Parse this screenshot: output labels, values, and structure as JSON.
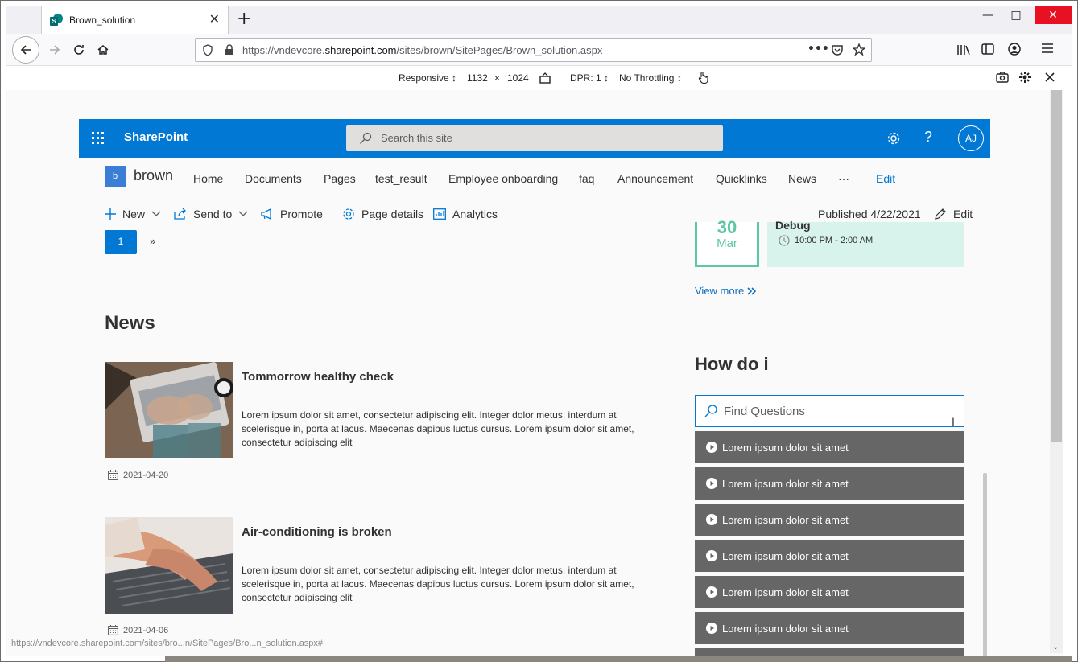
{
  "browser": {
    "tab_title": "Brown_solution",
    "url_prefix": "https://vndevcore.",
    "url_domain": "sharepoint.com",
    "url_suffix": "/sites/brown/SitePages/Brown_solution.aspx",
    "status_url": "https://vndevcore.sharepoint.com/sites/bro...n/SitePages/Bro...n_solution.aspx#"
  },
  "rdm": {
    "device": "Responsive ↕",
    "width": "1132",
    "times": "×",
    "height": "1024",
    "dpr": "DPR: 1 ↕",
    "throttle": "No Throttling ↕"
  },
  "suite": {
    "brand": "SharePoint",
    "search_placeholder": "Search this site",
    "avatar": "AJ",
    "help": "?"
  },
  "site": {
    "logo_letter": "b",
    "name": "brown",
    "nav": [
      "Home",
      "Documents",
      "Pages",
      "test_result",
      "Employee onboarding",
      "faq",
      "Announcement",
      "Quicklinks",
      "News",
      "···"
    ],
    "edit": "Edit"
  },
  "commands": {
    "new": "New",
    "send_to": "Send to",
    "promote": "Promote",
    "page_details": "Page details",
    "analytics": "Analytics",
    "published": "Published 4/22/2021",
    "edit": "Edit"
  },
  "pager": {
    "current": "1",
    "next": "»"
  },
  "news": {
    "title": "News",
    "items": [
      {
        "headline": "Tommorrow healthy check",
        "desc": "Lorem ipsum dolor sit amet, consectetur adipiscing elit. Integer dolor metus, interdum at scelerisque in, porta at lacus. Maecenas dapibus luctus cursus. Lorem ipsum dolor sit amet, consectetur adipiscing elit",
        "date": "2021-04-20"
      },
      {
        "headline": "Air-conditioning is broken",
        "desc": "Lorem ipsum dolor sit amet, consectetur adipiscing elit. Integer dolor metus, interdum at scelerisque in, porta at lacus. Maecenas dapibus luctus cursus. Lorem ipsum dolor sit amet, consectetur adipiscing elit",
        "date": "2021-04-06"
      }
    ]
  },
  "event": {
    "day": "30",
    "month": "Mar",
    "title": "Debug",
    "time": "10:00 PM - 2:00 AM"
  },
  "view_more": "View more",
  "howdoi": {
    "title": "How do i",
    "placeholder": "Find Questions",
    "items": [
      "Lorem ipsum dolor sit amet",
      "Lorem ipsum dolor sit amet",
      "Lorem ipsum dolor sit amet",
      "Lorem ipsum dolor sit amet",
      "Lorem ipsum dolor sit amet",
      "Lorem ipsum dolor sit amet"
    ]
  },
  "colors": {
    "brand_blue": "#0078d4",
    "event_green": "#5bc7a4",
    "event_bg": "#d7f3eb",
    "question_bg": "#666666"
  }
}
